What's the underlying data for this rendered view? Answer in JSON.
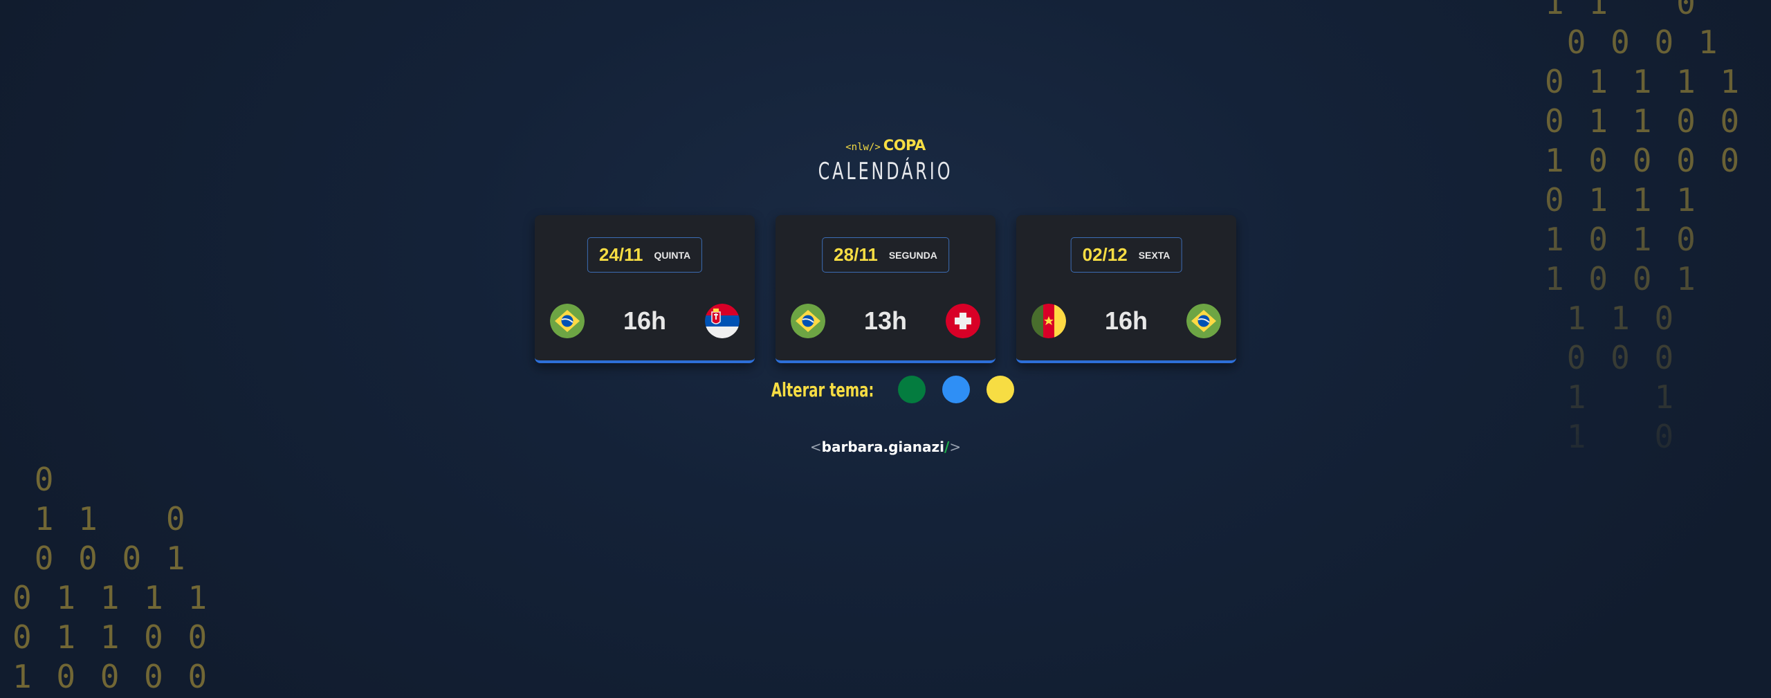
{
  "background_binary": {
    "right": "1 1   0\n 0 0 0 1\n0 1 1 1 1\n0 1 1 0 0\n1 0 0 0 0\n0 1 1 1\n1 0 1 0\n1 0 0 1\n 1 1 0\n 0 0 0\n 1   1\n 1   0",
    "left": " 0\n 1 1   0\n 0 0 0 1\n0 1 1 1 1\n0 1 1 0 0\n1 0 0 0 0"
  },
  "header": {
    "logo_tag": "<nlw/>",
    "logo_text": "COPA",
    "title": "CALENDÁRIO"
  },
  "cards": [
    {
      "date": "24/11",
      "weekday": "QUINTA",
      "time": "16h",
      "home_flag": "brazil-flag",
      "away_flag": "serbia-flag"
    },
    {
      "date": "28/11",
      "weekday": "SEGUNDA",
      "time": "13h",
      "home_flag": "brazil-flag",
      "away_flag": "switzerland-flag"
    },
    {
      "date": "02/12",
      "weekday": "SEXTA",
      "time": "16h",
      "home_flag": "cameroon-flag",
      "away_flag": "brazil-flag"
    }
  ],
  "theme": {
    "label": "Alterar tema:",
    "swatches": [
      "#047c3f",
      "#2f8ff5",
      "#f7dd43"
    ]
  },
  "signature": {
    "open": "<",
    "name": "barbara.gianazi",
    "slash": "/",
    "close": ">"
  },
  "colors": {
    "accent_yellow": "#f7dd43",
    "card_bg": "#1f2228",
    "card_border": "#2d6fd8"
  }
}
